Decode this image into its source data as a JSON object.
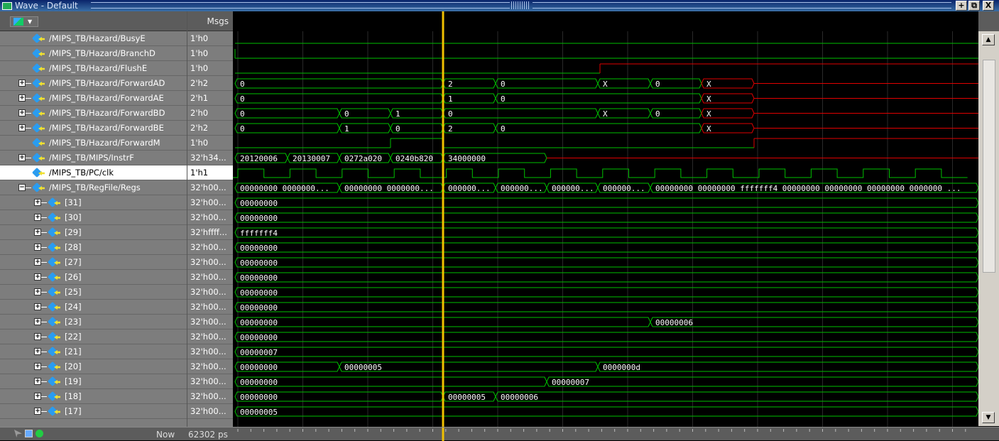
{
  "window": {
    "title": "Wave - Default",
    "buttons": [
      "+",
      "⧉",
      "X"
    ],
    "colors": {
      "title_start": "#0a246a",
      "title_end": "#3a6ea5"
    }
  },
  "header": {
    "msgs_label": "Msgs"
  },
  "signals": [
    {
      "name": "/MIPS_TB/Hazard/BusyE",
      "value": "1'h0",
      "expandable": false
    },
    {
      "name": "/MIPS_TB/Hazard/BranchD",
      "value": "1'h0",
      "expandable": false
    },
    {
      "name": "/MIPS_TB/Hazard/FlushE",
      "value": "1'h0",
      "expandable": false
    },
    {
      "name": "/MIPS_TB/Hazard/ForwardAD",
      "value": "2'h2",
      "expandable": true
    },
    {
      "name": "/MIPS_TB/Hazard/ForwardAE",
      "value": "2'h1",
      "expandable": true
    },
    {
      "name": "/MIPS_TB/Hazard/ForwardBD",
      "value": "2'h0",
      "expandable": true
    },
    {
      "name": "/MIPS_TB/Hazard/ForwardBE",
      "value": "2'h2",
      "expandable": true
    },
    {
      "name": "/MIPS_TB/Hazard/ForwardM",
      "value": "1'h0",
      "expandable": false
    },
    {
      "name": "/MIPS_TB/MIPS/InstrF",
      "value": "32'h34...",
      "expandable": true
    },
    {
      "name": "/MIPS_TB/PC/clk",
      "value": "1'h1",
      "expandable": false,
      "selected": true
    },
    {
      "name": "/MIPS_TB/RegFile/Regs",
      "value": "32'h00...",
      "expandable": true,
      "expanded": true
    },
    {
      "name": "[31]",
      "value": "32'h00...",
      "child": true
    },
    {
      "name": "[30]",
      "value": "32'h00...",
      "child": true
    },
    {
      "name": "[29]",
      "value": "32'hffff...",
      "child": true
    },
    {
      "name": "[28]",
      "value": "32'h00...",
      "child": true
    },
    {
      "name": "[27]",
      "value": "32'h00...",
      "child": true
    },
    {
      "name": "[26]",
      "value": "32'h00...",
      "child": true
    },
    {
      "name": "[25]",
      "value": "32'h00...",
      "child": true
    },
    {
      "name": "[24]",
      "value": "32'h00...",
      "child": true
    },
    {
      "name": "[23]",
      "value": "32'h00...",
      "child": true
    },
    {
      "name": "[22]",
      "value": "32'h00...",
      "child": true
    },
    {
      "name": "[21]",
      "value": "32'h00...",
      "child": true
    },
    {
      "name": "[20]",
      "value": "32'h00...",
      "child": true
    },
    {
      "name": "[19]",
      "value": "32'h00...",
      "child": true
    },
    {
      "name": "[18]",
      "value": "32'h00...",
      "child": true
    },
    {
      "name": "[17]",
      "value": "32'h00...",
      "child": true
    }
  ],
  "waves": {
    "bus_labels": [
      {
        "row": 3,
        "labels": [
          "0",
          "2",
          "0",
          "X",
          "0",
          "X"
        ]
      },
      {
        "row": 4,
        "labels": [
          "0",
          "1",
          "0",
          "X"
        ]
      },
      {
        "row": 5,
        "labels": [
          "0",
          "0",
          "1",
          "0",
          "X",
          "0",
          "X"
        ]
      },
      {
        "row": 6,
        "labels": [
          "0",
          "1",
          "0",
          "2",
          "0",
          "X"
        ]
      },
      {
        "row": 8,
        "labels": [
          "20120006",
          "20130007",
          "0272a020",
          "0240b820",
          "34000000"
        ]
      },
      {
        "row": 10,
        "labels": [
          "00000000 0000000...",
          "00000000 0000000...",
          "000000...",
          "000000...",
          "000000...",
          "000000...",
          "00000000 00000000 fffffff4 00000000 00000000 00000000 0000000 ..."
        ]
      },
      {
        "row": 11,
        "labels": [
          "00000000"
        ]
      },
      {
        "row": 12,
        "labels": [
          "00000000"
        ]
      },
      {
        "row": 13,
        "labels": [
          "fffffff4"
        ]
      },
      {
        "row": 14,
        "labels": [
          "00000000"
        ]
      },
      {
        "row": 15,
        "labels": [
          "00000000"
        ]
      },
      {
        "row": 16,
        "labels": [
          "00000000"
        ]
      },
      {
        "row": 17,
        "labels": [
          "00000000"
        ]
      },
      {
        "row": 18,
        "labels": [
          "00000000"
        ]
      },
      {
        "row": 19,
        "labels": [
          "00000000",
          "00000006"
        ]
      },
      {
        "row": 20,
        "labels": [
          "00000000"
        ]
      },
      {
        "row": 21,
        "labels": [
          "00000007"
        ]
      },
      {
        "row": 22,
        "labels": [
          "00000000",
          "00000005",
          "0000000d"
        ]
      },
      {
        "row": 23,
        "labels": [
          "00000000",
          "00000007"
        ]
      },
      {
        "row": 24,
        "labels": [
          "00000000",
          "00000005",
          "00000006"
        ]
      },
      {
        "row": 25,
        "labels": [
          "00000005"
        ]
      }
    ],
    "colors": {
      "signal": "#00c000",
      "unknown": "#e00000",
      "cursor": "#f0c000",
      "grid": "#2a2a2a"
    }
  },
  "statusbar": {
    "now_label": "Now",
    "now_value": "62302 ps",
    "icons": [
      "cursor-add-icon",
      "cursor-lock-icon",
      "cursor-delete-icon"
    ]
  }
}
